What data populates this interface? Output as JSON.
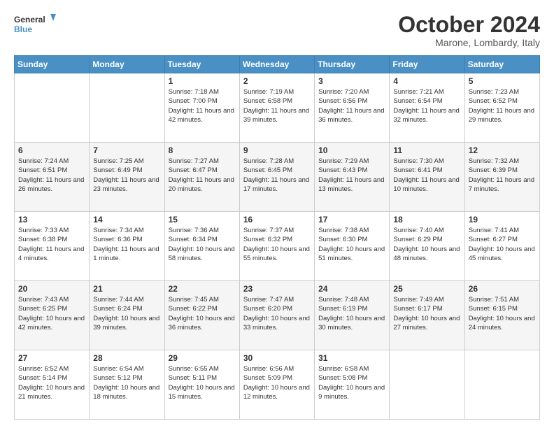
{
  "logo": {
    "line1": "General",
    "line2": "Blue"
  },
  "title": "October 2024",
  "location": "Marone, Lombardy, Italy",
  "days_header": [
    "Sunday",
    "Monday",
    "Tuesday",
    "Wednesday",
    "Thursday",
    "Friday",
    "Saturday"
  ],
  "weeks": [
    [
      {
        "day": "",
        "content": ""
      },
      {
        "day": "",
        "content": ""
      },
      {
        "day": "1",
        "content": "Sunrise: 7:18 AM\nSunset: 7:00 PM\nDaylight: 11 hours and 42 minutes."
      },
      {
        "day": "2",
        "content": "Sunrise: 7:19 AM\nSunset: 6:58 PM\nDaylight: 11 hours and 39 minutes."
      },
      {
        "day": "3",
        "content": "Sunrise: 7:20 AM\nSunset: 6:56 PM\nDaylight: 11 hours and 36 minutes."
      },
      {
        "day": "4",
        "content": "Sunrise: 7:21 AM\nSunset: 6:54 PM\nDaylight: 11 hours and 32 minutes."
      },
      {
        "day": "5",
        "content": "Sunrise: 7:23 AM\nSunset: 6:52 PM\nDaylight: 11 hours and 29 minutes."
      }
    ],
    [
      {
        "day": "6",
        "content": "Sunrise: 7:24 AM\nSunset: 6:51 PM\nDaylight: 11 hours and 26 minutes."
      },
      {
        "day": "7",
        "content": "Sunrise: 7:25 AM\nSunset: 6:49 PM\nDaylight: 11 hours and 23 minutes."
      },
      {
        "day": "8",
        "content": "Sunrise: 7:27 AM\nSunset: 6:47 PM\nDaylight: 11 hours and 20 minutes."
      },
      {
        "day": "9",
        "content": "Sunrise: 7:28 AM\nSunset: 6:45 PM\nDaylight: 11 hours and 17 minutes."
      },
      {
        "day": "10",
        "content": "Sunrise: 7:29 AM\nSunset: 6:43 PM\nDaylight: 11 hours and 13 minutes."
      },
      {
        "day": "11",
        "content": "Sunrise: 7:30 AM\nSunset: 6:41 PM\nDaylight: 11 hours and 10 minutes."
      },
      {
        "day": "12",
        "content": "Sunrise: 7:32 AM\nSunset: 6:39 PM\nDaylight: 11 hours and 7 minutes."
      }
    ],
    [
      {
        "day": "13",
        "content": "Sunrise: 7:33 AM\nSunset: 6:38 PM\nDaylight: 11 hours and 4 minutes."
      },
      {
        "day": "14",
        "content": "Sunrise: 7:34 AM\nSunset: 6:36 PM\nDaylight: 11 hours and 1 minute."
      },
      {
        "day": "15",
        "content": "Sunrise: 7:36 AM\nSunset: 6:34 PM\nDaylight: 10 hours and 58 minutes."
      },
      {
        "day": "16",
        "content": "Sunrise: 7:37 AM\nSunset: 6:32 PM\nDaylight: 10 hours and 55 minutes."
      },
      {
        "day": "17",
        "content": "Sunrise: 7:38 AM\nSunset: 6:30 PM\nDaylight: 10 hours and 51 minutes."
      },
      {
        "day": "18",
        "content": "Sunrise: 7:40 AM\nSunset: 6:29 PM\nDaylight: 10 hours and 48 minutes."
      },
      {
        "day": "19",
        "content": "Sunrise: 7:41 AM\nSunset: 6:27 PM\nDaylight: 10 hours and 45 minutes."
      }
    ],
    [
      {
        "day": "20",
        "content": "Sunrise: 7:43 AM\nSunset: 6:25 PM\nDaylight: 10 hours and 42 minutes."
      },
      {
        "day": "21",
        "content": "Sunrise: 7:44 AM\nSunset: 6:24 PM\nDaylight: 10 hours and 39 minutes."
      },
      {
        "day": "22",
        "content": "Sunrise: 7:45 AM\nSunset: 6:22 PM\nDaylight: 10 hours and 36 minutes."
      },
      {
        "day": "23",
        "content": "Sunrise: 7:47 AM\nSunset: 6:20 PM\nDaylight: 10 hours and 33 minutes."
      },
      {
        "day": "24",
        "content": "Sunrise: 7:48 AM\nSunset: 6:19 PM\nDaylight: 10 hours and 30 minutes."
      },
      {
        "day": "25",
        "content": "Sunrise: 7:49 AM\nSunset: 6:17 PM\nDaylight: 10 hours and 27 minutes."
      },
      {
        "day": "26",
        "content": "Sunrise: 7:51 AM\nSunset: 6:15 PM\nDaylight: 10 hours and 24 minutes."
      }
    ],
    [
      {
        "day": "27",
        "content": "Sunrise: 6:52 AM\nSunset: 5:14 PM\nDaylight: 10 hours and 21 minutes."
      },
      {
        "day": "28",
        "content": "Sunrise: 6:54 AM\nSunset: 5:12 PM\nDaylight: 10 hours and 18 minutes."
      },
      {
        "day": "29",
        "content": "Sunrise: 6:55 AM\nSunset: 5:11 PM\nDaylight: 10 hours and 15 minutes."
      },
      {
        "day": "30",
        "content": "Sunrise: 6:56 AM\nSunset: 5:09 PM\nDaylight: 10 hours and 12 minutes."
      },
      {
        "day": "31",
        "content": "Sunrise: 6:58 AM\nSunset: 5:08 PM\nDaylight: 10 hours and 9 minutes."
      },
      {
        "day": "",
        "content": ""
      },
      {
        "day": "",
        "content": ""
      }
    ]
  ]
}
